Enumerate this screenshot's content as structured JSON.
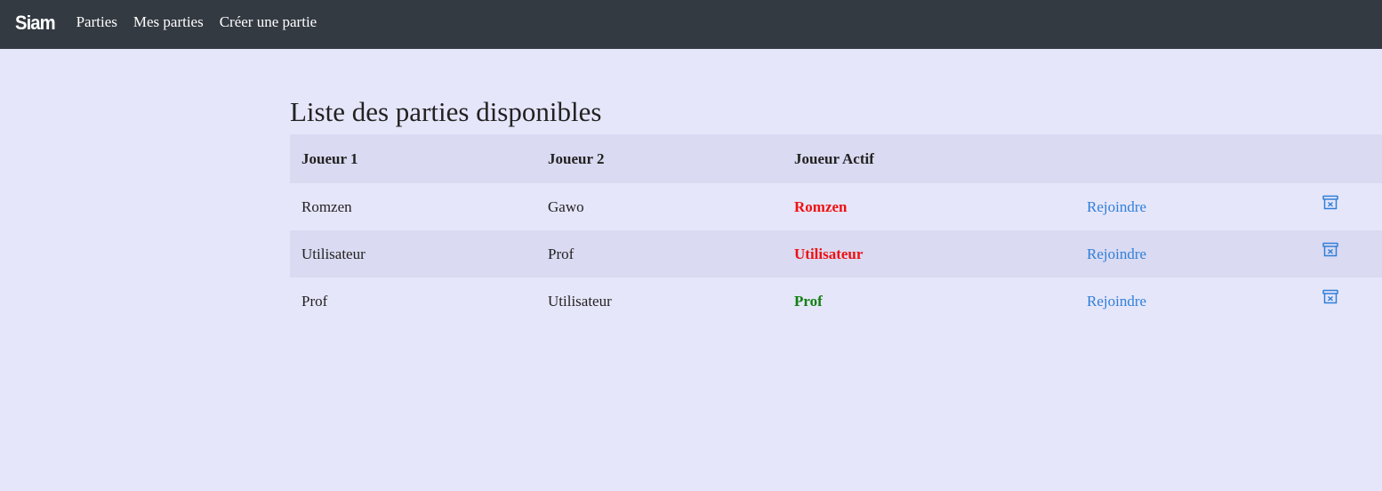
{
  "navbar": {
    "brand": "Siam",
    "links": [
      "Parties",
      "Mes parties",
      "Créer une partie"
    ]
  },
  "page": {
    "title": "Liste des parties disponibles"
  },
  "table": {
    "headers": [
      "Joueur 1",
      "Joueur 2",
      "Joueur Actif",
      "",
      ""
    ],
    "rows": [
      {
        "player1": "Romzen",
        "player2": "Gawo",
        "active": "Romzen",
        "active_color": "#ee1111",
        "join": "Rejoindre",
        "action_icon": "trash-icon"
      },
      {
        "player1": "Utilisateur",
        "player2": "Prof",
        "active": "Utilisateur",
        "active_color": "#ee1111",
        "join": "Rejoindre",
        "action_icon": "trash-icon"
      },
      {
        "player1": "Prof",
        "player2": "Utilisateur",
        "active": "Prof",
        "active_color": "#108010",
        "join": "Rejoindre",
        "action_icon": "trash-icon"
      }
    ]
  },
  "colors": {
    "navbar_bg": "#343a42",
    "page_bg": "#e6e6fb",
    "stripe_bg": "#dadaf2",
    "link": "#2f7fd8",
    "active_turn": "#108010",
    "waiting_turn": "#ee1111"
  }
}
